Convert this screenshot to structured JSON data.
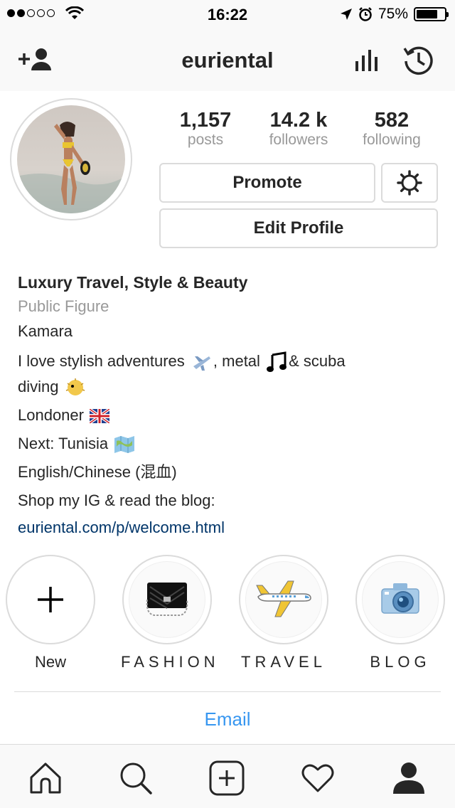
{
  "status_bar": {
    "signal_dots_filled": 2,
    "signal_dots_total": 5,
    "time": "16:22",
    "battery": "75%",
    "battery_level": 0.75
  },
  "nav": {
    "title": "euriental",
    "icons": [
      "add-person-icon",
      "insights-icon",
      "archive-icon"
    ]
  },
  "stats": [
    {
      "value": "1,157",
      "label": "posts"
    },
    {
      "value": "14.2 k",
      "label": "followers"
    },
    {
      "value": "582",
      "label": "following"
    }
  ],
  "buttons": {
    "promote": "Promote",
    "edit_profile": "Edit Profile"
  },
  "bio": {
    "name": "Luxury Travel, Style & Beauty",
    "category": "Public Figure",
    "line1": "Kamara",
    "line2a": "I love stylish adventures",
    "line2b": ", metal",
    "line2c": "& scuba",
    "line3": "diving",
    "line4": "Londoner",
    "line5": "Next: Tunisia",
    "line6": "English/Chinese (混血)",
    "line7": "Shop my IG & read the blog:",
    "link": "euriental.com/p/welcome.html"
  },
  "highlights": [
    {
      "label": "New"
    },
    {
      "label": "FASHION"
    },
    {
      "label": "TRAVEL"
    },
    {
      "label": "BLOG"
    }
  ],
  "contact": {
    "email": "Email"
  },
  "tabbar": [
    "home-icon",
    "search-icon",
    "new-post-icon",
    "activity-heart-icon",
    "profile-icon"
  ],
  "colors": {
    "link_blue": "#3897f0",
    "bio_link": "#003569",
    "text": "#262626",
    "muted": "#999999"
  }
}
